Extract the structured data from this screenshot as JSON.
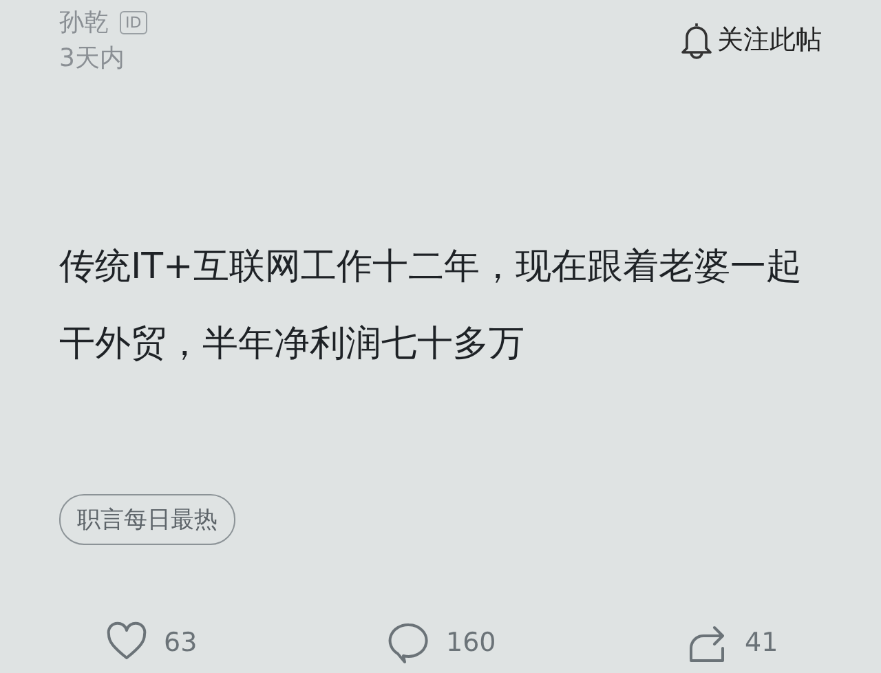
{
  "author": {
    "name": "孙乾",
    "badge": "ID",
    "time": "3天内"
  },
  "follow": {
    "label": "关注此帖"
  },
  "post": {
    "text": "传统IT+互联网工作十二年，现在跟着老婆一起干外贸，半年净利润七十多万"
  },
  "tag": "职言每日最热",
  "actions": [
    {
      "kind": "like",
      "count": "63"
    },
    {
      "kind": "comment",
      "count": "160"
    },
    {
      "kind": "share",
      "count": "41"
    }
  ]
}
